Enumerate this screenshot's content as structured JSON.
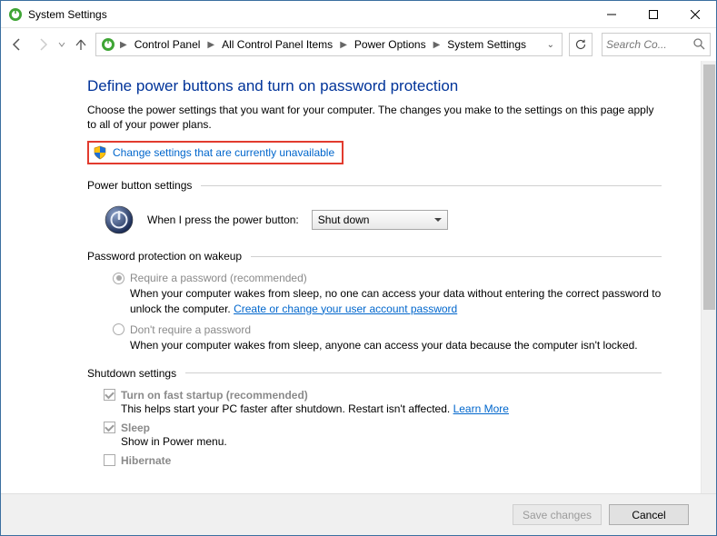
{
  "window": {
    "title": "System Settings"
  },
  "breadcrumb": {
    "items": [
      "Control Panel",
      "All Control Panel Items",
      "Power Options",
      "System Settings"
    ]
  },
  "search": {
    "placeholder": "Search Co..."
  },
  "page": {
    "title": "Define power buttons and turn on password protection",
    "intro": "Choose the power settings that you want for your computer. The changes you make to the settings on this page apply to all of your power plans.",
    "change_link": "Change settings that are currently unavailable"
  },
  "power_button": {
    "header": "Power button settings",
    "label": "When I press the power button:",
    "selected": "Shut down"
  },
  "password": {
    "header": "Password protection on wakeup",
    "opt1_label": "Require a password (recommended)",
    "opt1_desc_a": "When your computer wakes from sleep, no one can access your data without entering the correct password to unlock the computer. ",
    "opt1_link": "Create or change your user account password",
    "opt2_label": "Don't require a password",
    "opt2_desc": "When your computer wakes from sleep, anyone can access your data because the computer isn't locked."
  },
  "shutdown": {
    "header": "Shutdown settings",
    "opt1_label": "Turn on fast startup (recommended)",
    "opt1_desc_a": "This helps start your PC faster after shutdown. Restart isn't affected. ",
    "opt1_link": "Learn More",
    "opt2_label": "Sleep",
    "opt2_desc": "Show in Power menu.",
    "opt3_label": "Hibernate"
  },
  "footer": {
    "save": "Save changes",
    "cancel": "Cancel"
  }
}
